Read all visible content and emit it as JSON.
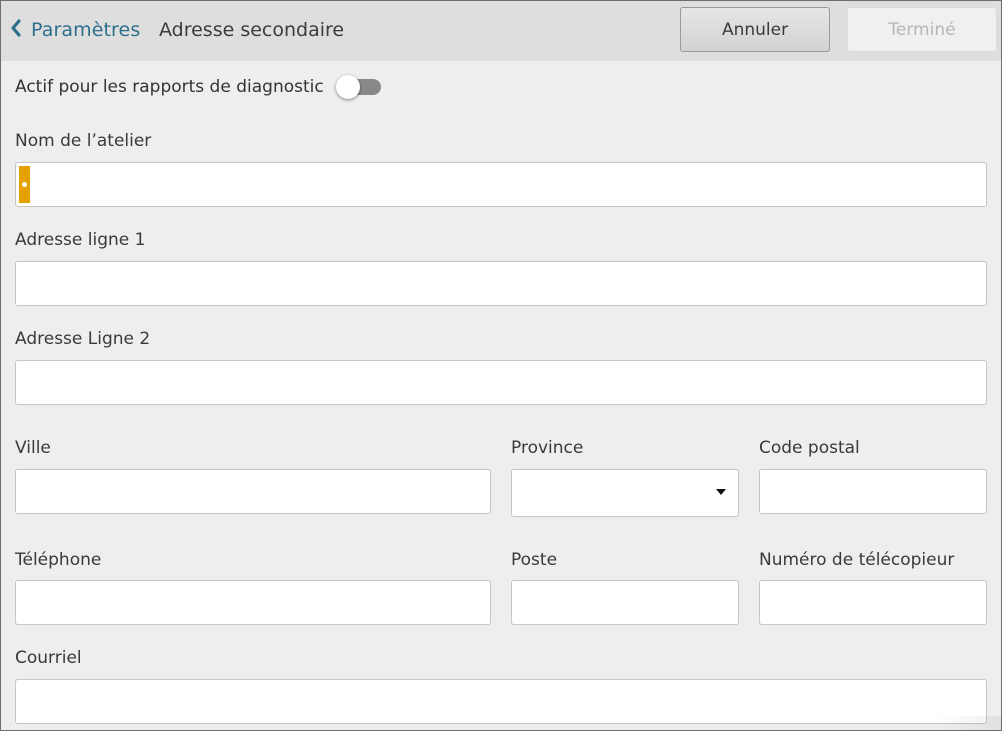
{
  "header": {
    "back_label": "Paramètres",
    "title": "Adresse secondaire",
    "cancel_label": "Annuler",
    "done_label": "Terminé"
  },
  "diagnostic": {
    "label": "Actif pour les rapports de diagnostic",
    "enabled": false
  },
  "fields": {
    "shop_name": {
      "label": "Nom de l’atelier",
      "value": ""
    },
    "address1": {
      "label": "Adresse ligne 1",
      "value": ""
    },
    "address2": {
      "label": "Adresse Ligne 2",
      "value": ""
    },
    "city": {
      "label": "Ville",
      "value": ""
    },
    "province": {
      "label": "Province",
      "value": ""
    },
    "postal_code": {
      "label": "Code postal",
      "value": ""
    },
    "phone": {
      "label": "Téléphone",
      "value": ""
    },
    "extension": {
      "label": "Poste",
      "value": ""
    },
    "fax": {
      "label": "Numéro de télécopieur",
      "value": ""
    },
    "email": {
      "label": "Courriel",
      "value": ""
    }
  },
  "colors": {
    "link": "#2e6f8c",
    "focus_marker": "#e5a100",
    "toggle_off": "#888888"
  }
}
